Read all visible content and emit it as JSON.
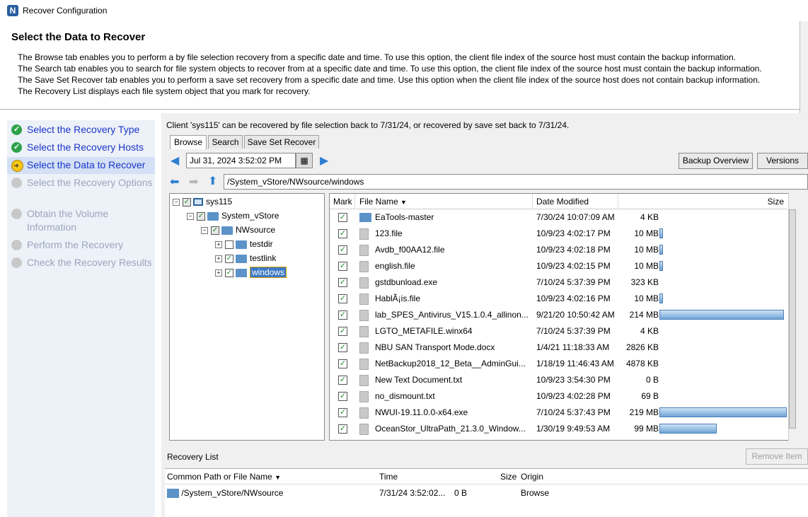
{
  "window": {
    "title": "Recover Configuration",
    "app_icon_letter": "N"
  },
  "header": {
    "title": "Select the Data to Recover",
    "description": [
      "The Browse tab enables you to perform a by file selection recovery from a specific date and time. To use this option, the client file index of the source host must contain the backup information.",
      "The Search tab enables you to search for file system objects to recover from at a specific date and time. To use this option, the client file index of the source host must contain the backup information.",
      "The Save Set Recover tab enables you to perform a save set recovery from a specific date and time.  Use this option when the client file index of the source host does not contain backup information.",
      "The Recovery List displays each file system object that you mark for recovery."
    ]
  },
  "steps": [
    {
      "label": "Select the Recovery Type",
      "state": "done"
    },
    {
      "label": "Select the Recovery Hosts",
      "state": "done"
    },
    {
      "label": "Select the Data to Recover",
      "state": "current"
    },
    {
      "label": "Select the Recovery Options",
      "state": "todo"
    },
    {
      "label": "Obtain the Volume Information",
      "state": "todo"
    },
    {
      "label": "Perform the Recovery",
      "state": "todo"
    },
    {
      "label": "Check the Recovery Results",
      "state": "todo"
    }
  ],
  "main": {
    "client_message": "Client 'sys115' can be recovered by file selection back to 7/31/24, or recovered by save set back to 7/31/24.",
    "tabs": [
      "Browse",
      "Search",
      "Save Set Recover"
    ],
    "date_value": "Jul 31, 2024 3:52:02 PM",
    "buttons": {
      "backup_overview": "Backup Overview",
      "versions": "Versions"
    },
    "path": "/System_vStore/NWsource/windows"
  },
  "tree": {
    "root": "sys115",
    "store": "System_vStore",
    "source": "NWsource",
    "children": [
      {
        "name": "testdir",
        "checked": false
      },
      {
        "name": "testlink",
        "checked": true
      },
      {
        "name": "windows",
        "checked": true,
        "selected": true
      }
    ]
  },
  "files": {
    "columns": {
      "mark": "Mark",
      "name": "File Name",
      "modified": "Date Modified",
      "size": "Size"
    },
    "rows": [
      {
        "name": "EaTools-master",
        "modified": "7/30/24 10:07:09 AM",
        "size": "4 KB",
        "type": "folder",
        "bar": 0
      },
      {
        "name": "123.file",
        "modified": "10/9/23 4:02:17 PM",
        "size": "10 MB",
        "type": "file",
        "bar": 0.02
      },
      {
        "name": "Avdb_f00AA12.file",
        "modified": "10/9/23 4:02:18 PM",
        "size": "10 MB",
        "type": "file",
        "bar": 0.02
      },
      {
        "name": "english.file",
        "modified": "10/9/23 4:02:15 PM",
        "size": "10 MB",
        "type": "file",
        "bar": 0.02
      },
      {
        "name": "gstdbunload.exe",
        "modified": "7/10/24 5:37:39 PM",
        "size": "323 KB",
        "type": "file",
        "bar": 0
      },
      {
        "name": "HablÃ¡is.file",
        "modified": "10/9/23 4:02:16 PM",
        "size": "10 MB",
        "type": "file",
        "bar": 0.02
      },
      {
        "name": "lab_SPES_Antivirus_V15.1.0.4_allinon...",
        "modified": "9/21/20 10:50:42 AM",
        "size": "214 MB",
        "type": "file",
        "bar": 0.98
      },
      {
        "name": "LGTO_METAFILE.winx64",
        "modified": "7/10/24 5:37:39 PM",
        "size": "4 KB",
        "type": "file",
        "bar": 0
      },
      {
        "name": "NBU SAN Transport Mode.docx",
        "modified": "1/4/21 11:18:33 AM",
        "size": "2826 KB",
        "type": "file",
        "bar": 0
      },
      {
        "name": "NetBackup2018_12_Beta__AdminGui...",
        "modified": "1/18/19 11:46:43 AM",
        "size": "4878 KB",
        "type": "file",
        "bar": 0
      },
      {
        "name": "New Text Document.txt",
        "modified": "10/9/23 3:54:30 PM",
        "size": "0 B",
        "type": "file",
        "bar": 0
      },
      {
        "name": "no_dismount.txt",
        "modified": "10/9/23 4:02:28 PM",
        "size": "69 B",
        "type": "file",
        "bar": 0
      },
      {
        "name": "NWUI-19.11.0.0-x64.exe",
        "modified": "7/10/24 5:37:43 PM",
        "size": "219 MB",
        "type": "file",
        "bar": 1.0
      },
      {
        "name": "OceanStor_UltraPath_21.3.0_Window...",
        "modified": "1/30/19 9:49:53 AM",
        "size": "99 MB",
        "type": "file",
        "bar": 0.45
      }
    ]
  },
  "recovery_list": {
    "label": "Recovery List",
    "remove_button": "Remove Item",
    "columns": {
      "path": "Common Path or File Name",
      "time": "Time",
      "size": "Size",
      "origin": "Origin"
    },
    "rows": [
      {
        "path": "/System_vStore/NWsource",
        "time": "7/31/24 3:52:02...",
        "size": "0 B",
        "origin": "Browse"
      }
    ]
  }
}
